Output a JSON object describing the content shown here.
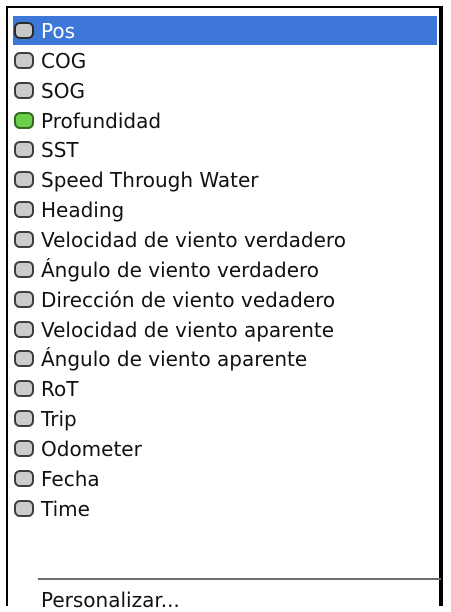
{
  "menu": {
    "items": [
      {
        "label": "Pos",
        "checked": false,
        "selected": true
      },
      {
        "label": "COG",
        "checked": false,
        "selected": false
      },
      {
        "label": "SOG",
        "checked": false,
        "selected": false
      },
      {
        "label": "Profundidad",
        "checked": true,
        "selected": false
      },
      {
        "label": "SST",
        "checked": false,
        "selected": false
      },
      {
        "label": "Speed Through Water",
        "checked": false,
        "selected": false
      },
      {
        "label": "Heading",
        "checked": false,
        "selected": false
      },
      {
        "label": "Velocidad de viento verdadero",
        "checked": false,
        "selected": false
      },
      {
        "label": "Ángulo de viento verdadero",
        "checked": false,
        "selected": false
      },
      {
        "label": "Dirección de viento vedadero",
        "checked": false,
        "selected": false
      },
      {
        "label": "Velocidad de viento aparente",
        "checked": false,
        "selected": false
      },
      {
        "label": "Ángulo de viento aparente",
        "checked": false,
        "selected": false
      },
      {
        "label": "RoT",
        "checked": false,
        "selected": false
      },
      {
        "label": "Trip",
        "checked": false,
        "selected": false
      },
      {
        "label": "Odometer",
        "checked": false,
        "selected": false
      },
      {
        "label": "Fecha",
        "checked": false,
        "selected": false
      },
      {
        "label": "Time",
        "checked": false,
        "selected": false
      }
    ],
    "customize_label": "Personalizar..."
  },
  "colors": {
    "highlight": "#3d78d9",
    "checked": "#6ad04a",
    "unchecked": "#cbcbcb"
  }
}
